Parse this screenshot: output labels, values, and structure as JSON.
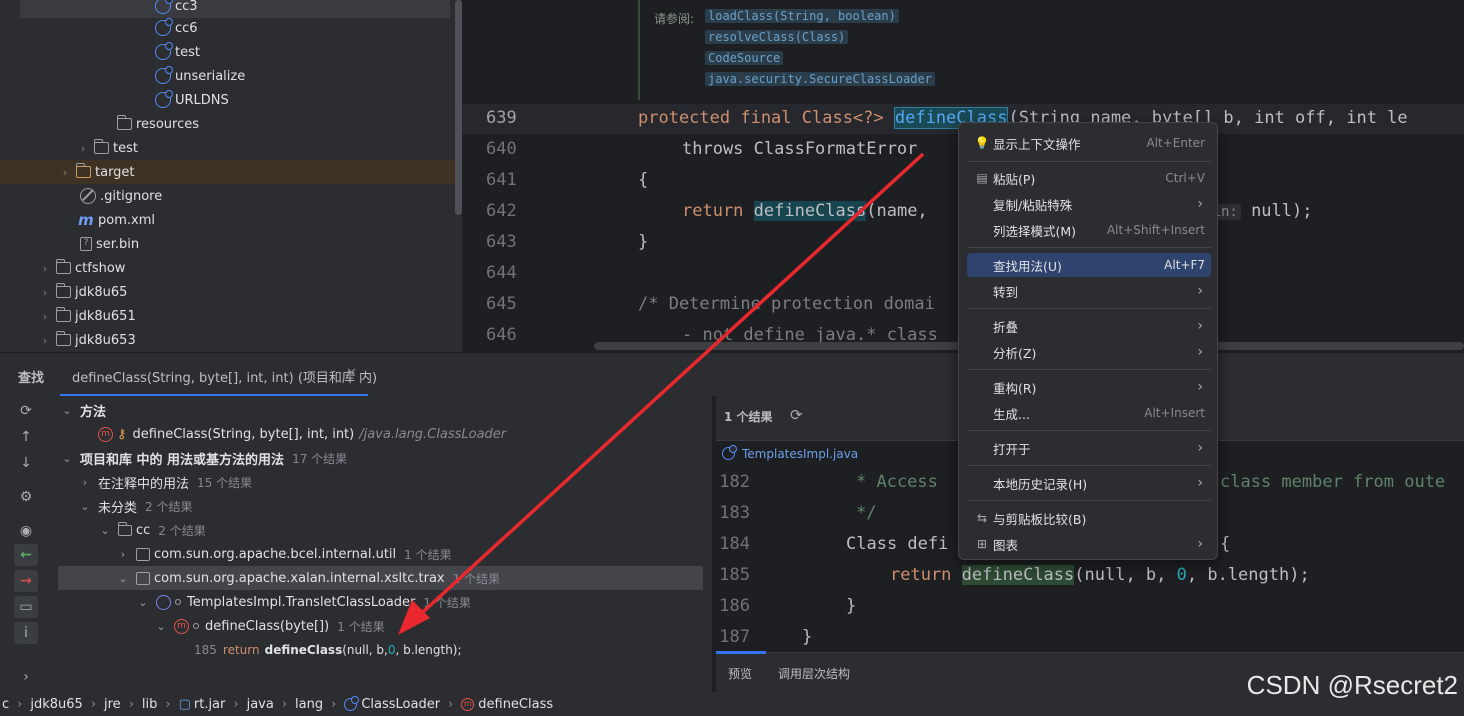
{
  "project_tree": {
    "items": [
      {
        "label": "cc3",
        "icon": "java-class-icon"
      },
      {
        "label": "cc6",
        "icon": "java-class-icon"
      },
      {
        "label": "test",
        "icon": "java-class-icon"
      },
      {
        "label": "unserialize",
        "icon": "java-class-icon"
      },
      {
        "label": "URLDNS",
        "icon": "java-class-icon"
      },
      {
        "label": "resources",
        "icon": "folder-icon"
      },
      {
        "label": "test",
        "icon": "folder-icon"
      },
      {
        "label": "target",
        "icon": "folder-icon"
      },
      {
        "label": ".gitignore",
        "icon": "gitignore-icon"
      },
      {
        "label": "pom.xml",
        "icon": "maven-icon"
      },
      {
        "label": "ser.bin",
        "icon": "binary-file-icon"
      },
      {
        "label": "ctfshow",
        "icon": "folder-icon"
      },
      {
        "label": "jdk8u65",
        "icon": "folder-icon"
      },
      {
        "label": "jdk8u651",
        "icon": "folder-icon"
      },
      {
        "label": "jdk8u653",
        "icon": "folder-icon"
      }
    ]
  },
  "editor": {
    "doc_label": "请参阅:",
    "doc_links": [
      "loadClass(String, boolean)",
      "resolveClass(Class)",
      "CodeSource",
      "java.security.SecureClassLoader"
    ],
    "line_numbers": [
      "639",
      "640",
      "641",
      "642",
      "643",
      "644",
      "645",
      "646"
    ],
    "line_639": {
      "prefix": "protected final Class<?> ",
      "highlight": "defineClass",
      "suffix": "(String name, byte[] b, int off, int le"
    },
    "line_640": "throws ClassFormatError",
    "line_641": "{",
    "line_642_pre": "return ",
    "line_642_hl": "defineClass",
    "line_642_mid": "(name,",
    "line_642_hint": "main:",
    "line_642_post": " null);",
    "line_643": "}",
    "line_645": "/* Determine protection domai",
    "line_646": "- not define java.* class"
  },
  "find": {
    "tool_title": "查找",
    "tab_label": "defineClass(String, byte[], int, int) (项目和库 内)",
    "tree": {
      "method_group": "方法",
      "method_entry": "defineClass(String, byte[], int, int)",
      "method_path": "/java.lang.ClassLoader",
      "usages_group": "项目和库 中的 用法或基方法的用法",
      "usages_count": "17 个结果",
      "in_comments": "在注释中的用法",
      "in_comments_count": "15 个结果",
      "unclassified": "未分类",
      "unclassified_count": "2 个结果",
      "cc": "cc",
      "cc_count": "2 个结果",
      "pkg_bcel": "com.sun.org.apache.bcel.internal.util",
      "pkg_bcel_count": "1 个结果",
      "pkg_xsltc": "com.sun.org.apache.xalan.internal.xsltc.trax",
      "pkg_xsltc_count": "1 个结果",
      "cls_loader": "TemplatesImpl.TransletClassLoader",
      "cls_loader_count": "1 个结果",
      "method_usage": "defineClass(byte[])",
      "method_usage_count": "1 个结果",
      "usage_line_no": "185",
      "usage_kw": "return",
      "usage_call": "defineClass",
      "usage_args_pre": "(null, b, ",
      "usage_zero": "0",
      "usage_args_post": ", b.length);"
    },
    "preview": {
      "result_count": "1 个结果",
      "file_name": "TemplatesImpl.java",
      "line_numbers": [
        "182",
        "183",
        "184",
        "185",
        "186",
        "187"
      ],
      "line_182": "* Access ",
      "line_182b": "class member from oute",
      "line_183": "*/",
      "line_184": "Class defi",
      "line_184b": "{",
      "line_185_kw": "return",
      "line_185_call": "defineClass",
      "line_185_pre": "(null, b, ",
      "line_185_zero": "0",
      "line_185_post": ", b.length);",
      "line_186": "}",
      "line_187": "}",
      "tab_preview": "预览",
      "tab_hierarchy": "调用层次结构"
    }
  },
  "context_menu": {
    "items": [
      {
        "icon": "lightbulb-icon",
        "label": "显示上下文操作",
        "shortcut": "Alt+Enter"
      },
      {
        "icon": "clipboard-icon",
        "label": "粘贴(P)",
        "shortcut": "Ctrl+V"
      },
      {
        "icon": "",
        "label": "复制/粘贴特殊",
        "shortcut": "",
        "submenu": "›"
      },
      {
        "icon": "",
        "label": "列选择模式(M)",
        "shortcut": "Alt+Shift+Insert"
      },
      {
        "icon": "",
        "label": "查找用法(U)",
        "shortcut": "Alt+F7",
        "active": true
      },
      {
        "icon": "",
        "label": "转到",
        "shortcut": "",
        "submenu": "›"
      },
      {
        "icon": "",
        "label": "折叠",
        "shortcut": "",
        "submenu": "›"
      },
      {
        "icon": "",
        "label": "分析(Z)",
        "shortcut": "",
        "submenu": "›"
      },
      {
        "icon": "",
        "label": "重构(R)",
        "shortcut": "",
        "submenu": "›"
      },
      {
        "icon": "",
        "label": "生成...",
        "shortcut": "Alt+Insert"
      },
      {
        "icon": "",
        "label": "打开于",
        "shortcut": "",
        "submenu": "›"
      },
      {
        "icon": "",
        "label": "本地历史记录(H)",
        "shortcut": "",
        "submenu": "›"
      },
      {
        "icon": "compare-icon",
        "label": "与剪贴板比较(B)",
        "shortcut": ""
      },
      {
        "icon": "diagram-icon",
        "label": "图表",
        "shortcut": "",
        "submenu": "›"
      }
    ]
  },
  "status_bar": {
    "crumbs": [
      "c",
      "jdk8u65",
      "jre",
      "lib",
      "rt.jar",
      "java",
      "lang",
      "ClassLoader",
      "defineClass"
    ]
  },
  "watermark": "CSDN @Rsecret2",
  "colors": {
    "arrow": "#e8282d",
    "selection": "#2e436e",
    "accent": "#548af7"
  }
}
